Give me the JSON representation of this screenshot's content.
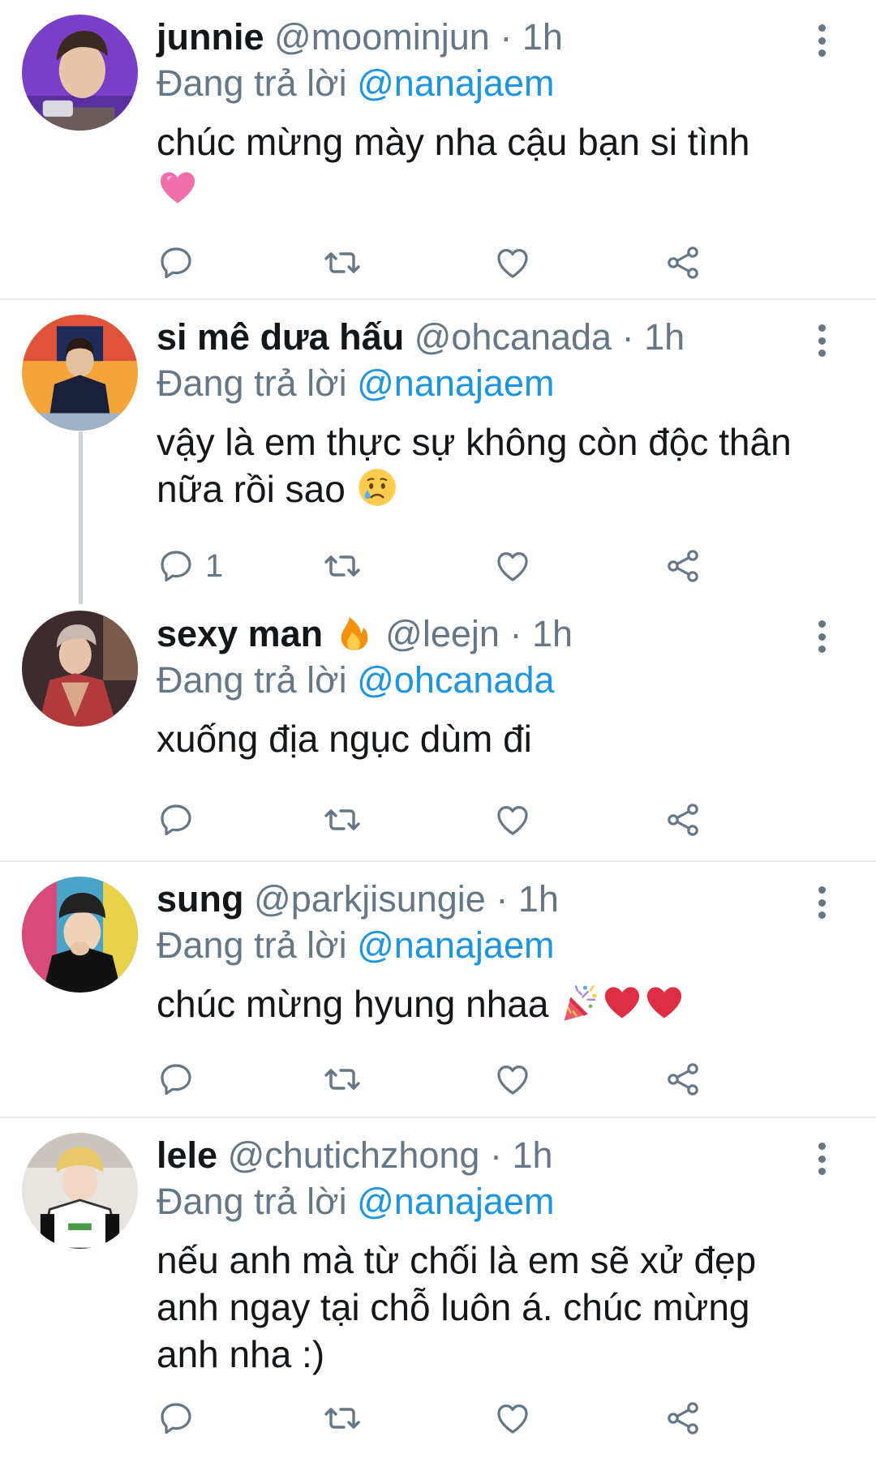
{
  "reply_prefix": "Đang trả lời",
  "tweets": [
    {
      "name": "junnie",
      "handle": "@moominjun",
      "time": "1h",
      "reply_to": "@nanajaem",
      "text": "chúc mừng mày nha cậu bạn si tình",
      "emojis": [
        "pink-heart"
      ],
      "reply_count": ""
    },
    {
      "name": "si mê dưa hấu",
      "handle": "@ohcanada",
      "time": "1h",
      "reply_to": "@nanajaem",
      "text": "vậy là em thực sự không còn độc thân nữa rồi sao",
      "emojis": [
        "crying-face"
      ],
      "reply_count": "1"
    },
    {
      "name": "sexy man",
      "name_emoji": "fire",
      "handle": "@leejn",
      "time": "1h",
      "reply_to": "@ohcanada",
      "text": "xuống địa ngục dùm đi",
      "emojis": [],
      "reply_count": ""
    },
    {
      "name": "sung",
      "handle": "@parkjisungie",
      "time": "1h",
      "reply_to": "@nanajaem",
      "text": "chúc mừng hyung nhaa",
      "emojis": [
        "confetti",
        "red-heart",
        "red-heart"
      ],
      "reply_count": ""
    },
    {
      "name": "lele",
      "handle": "@chutichzhong",
      "time": "1h",
      "reply_to": "@nanajaem",
      "text": "nếu anh mà từ chối là em sẽ xử đẹp anh ngay tại chỗ luôn á. chúc mừng anh nha :)",
      "emojis": [],
      "reply_count": ""
    }
  ],
  "colors": {
    "accent": "#1b95e0",
    "secondary": "#657786",
    "divider": "#e6ecf0"
  }
}
